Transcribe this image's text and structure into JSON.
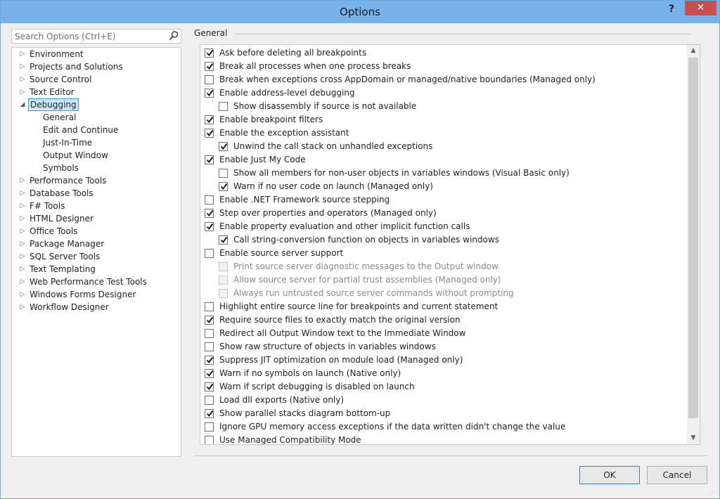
{
  "window": {
    "title": "Options",
    "help_label": "?",
    "close_label": "✕"
  },
  "search": {
    "placeholder": "Search Options (Ctrl+E)"
  },
  "tree": [
    {
      "label": "Environment",
      "level": 0,
      "expander": "collapsed"
    },
    {
      "label": "Projects and Solutions",
      "level": 0,
      "expander": "collapsed"
    },
    {
      "label": "Source Control",
      "level": 0,
      "expander": "collapsed"
    },
    {
      "label": "Text Editor",
      "level": 0,
      "expander": "collapsed"
    },
    {
      "label": "Debugging",
      "level": 0,
      "expander": "expanded",
      "selected": true
    },
    {
      "label": "General",
      "level": 1,
      "expander": "none"
    },
    {
      "label": "Edit and Continue",
      "level": 1,
      "expander": "none"
    },
    {
      "label": "Just-In-Time",
      "level": 1,
      "expander": "none"
    },
    {
      "label": "Output Window",
      "level": 1,
      "expander": "none"
    },
    {
      "label": "Symbols",
      "level": 1,
      "expander": "none"
    },
    {
      "label": "Performance Tools",
      "level": 0,
      "expander": "collapsed"
    },
    {
      "label": "Database Tools",
      "level": 0,
      "expander": "collapsed"
    },
    {
      "label": "F# Tools",
      "level": 0,
      "expander": "collapsed"
    },
    {
      "label": "HTML Designer",
      "level": 0,
      "expander": "collapsed"
    },
    {
      "label": "Office Tools",
      "level": 0,
      "expander": "collapsed"
    },
    {
      "label": "Package Manager",
      "level": 0,
      "expander": "collapsed"
    },
    {
      "label": "SQL Server Tools",
      "level": 0,
      "expander": "collapsed"
    },
    {
      "label": "Text Templating",
      "level": 0,
      "expander": "collapsed"
    },
    {
      "label": "Web Performance Test Tools",
      "level": 0,
      "expander": "collapsed"
    },
    {
      "label": "Windows Forms Designer",
      "level": 0,
      "expander": "collapsed"
    },
    {
      "label": "Workflow Designer",
      "level": 0,
      "expander": "collapsed"
    }
  ],
  "group": {
    "label": "General"
  },
  "options": [
    {
      "label": "Ask before deleting all breakpoints",
      "checked": true,
      "level": 0,
      "enabled": true
    },
    {
      "label": "Break all processes when one process breaks",
      "checked": true,
      "level": 0,
      "enabled": true
    },
    {
      "label": "Break when exceptions cross AppDomain or managed/native boundaries (Managed only)",
      "checked": false,
      "level": 0,
      "enabled": true
    },
    {
      "label": "Enable address-level debugging",
      "checked": true,
      "level": 0,
      "enabled": true
    },
    {
      "label": "Show disassembly if source is not available",
      "checked": false,
      "level": 1,
      "enabled": true
    },
    {
      "label": "Enable breakpoint filters",
      "checked": true,
      "level": 0,
      "enabled": true
    },
    {
      "label": "Enable the exception assistant",
      "checked": true,
      "level": 0,
      "enabled": true
    },
    {
      "label": "Unwind the call stack on unhandled exceptions",
      "checked": true,
      "level": 1,
      "enabled": true
    },
    {
      "label": "Enable Just My Code",
      "checked": true,
      "level": 0,
      "enabled": true
    },
    {
      "label": "Show all members for non-user objects in variables windows (Visual Basic only)",
      "checked": false,
      "level": 1,
      "enabled": true
    },
    {
      "label": "Warn if no user code on launch (Managed only)",
      "checked": true,
      "level": 1,
      "enabled": true
    },
    {
      "label": "Enable .NET Framework source stepping",
      "checked": false,
      "level": 0,
      "enabled": true
    },
    {
      "label": "Step over properties and operators (Managed only)",
      "checked": true,
      "level": 0,
      "enabled": true
    },
    {
      "label": "Enable property evaluation and other implicit function calls",
      "checked": true,
      "level": 0,
      "enabled": true
    },
    {
      "label": "Call string-conversion function on objects in variables windows",
      "checked": true,
      "level": 1,
      "enabled": true
    },
    {
      "label": "Enable source server support",
      "checked": false,
      "level": 0,
      "enabled": true
    },
    {
      "label": "Print source server diagnostic messages to the Output window",
      "checked": false,
      "level": 1,
      "enabled": false
    },
    {
      "label": "Allow source server for partial trust assemblies (Managed only)",
      "checked": false,
      "level": 1,
      "enabled": false
    },
    {
      "label": "Always run untrusted source server commands without prompting",
      "checked": false,
      "level": 1,
      "enabled": false
    },
    {
      "label": "Highlight entire source line for breakpoints and current statement",
      "checked": false,
      "level": 0,
      "enabled": true
    },
    {
      "label": "Require source files to exactly match the original version",
      "checked": true,
      "level": 0,
      "enabled": true
    },
    {
      "label": "Redirect all Output Window text to the Immediate Window",
      "checked": false,
      "level": 0,
      "enabled": true
    },
    {
      "label": "Show raw structure of objects in variables windows",
      "checked": false,
      "level": 0,
      "enabled": true
    },
    {
      "label": "Suppress JIT optimization on module load (Managed only)",
      "checked": true,
      "level": 0,
      "enabled": true
    },
    {
      "label": "Warn if no symbols on launch (Native only)",
      "checked": true,
      "level": 0,
      "enabled": true
    },
    {
      "label": "Warn if script debugging is disabled on launch",
      "checked": true,
      "level": 0,
      "enabled": true
    },
    {
      "label": "Load dll exports (Native only)",
      "checked": false,
      "level": 0,
      "enabled": true
    },
    {
      "label": "Show parallel stacks diagram bottom-up",
      "checked": true,
      "level": 0,
      "enabled": true
    },
    {
      "label": "Ignore GPU memory access exceptions if the data written didn't change the value",
      "checked": false,
      "level": 0,
      "enabled": true
    },
    {
      "label": "Use Managed Compatibility Mode",
      "checked": false,
      "level": 0,
      "enabled": true
    }
  ],
  "buttons": {
    "ok": "OK",
    "cancel": "Cancel"
  },
  "colors": {
    "titlebar": "#77b2e8",
    "close": "#c74f50",
    "selection": "#cce8ff",
    "selection_border": "#3399ff"
  }
}
